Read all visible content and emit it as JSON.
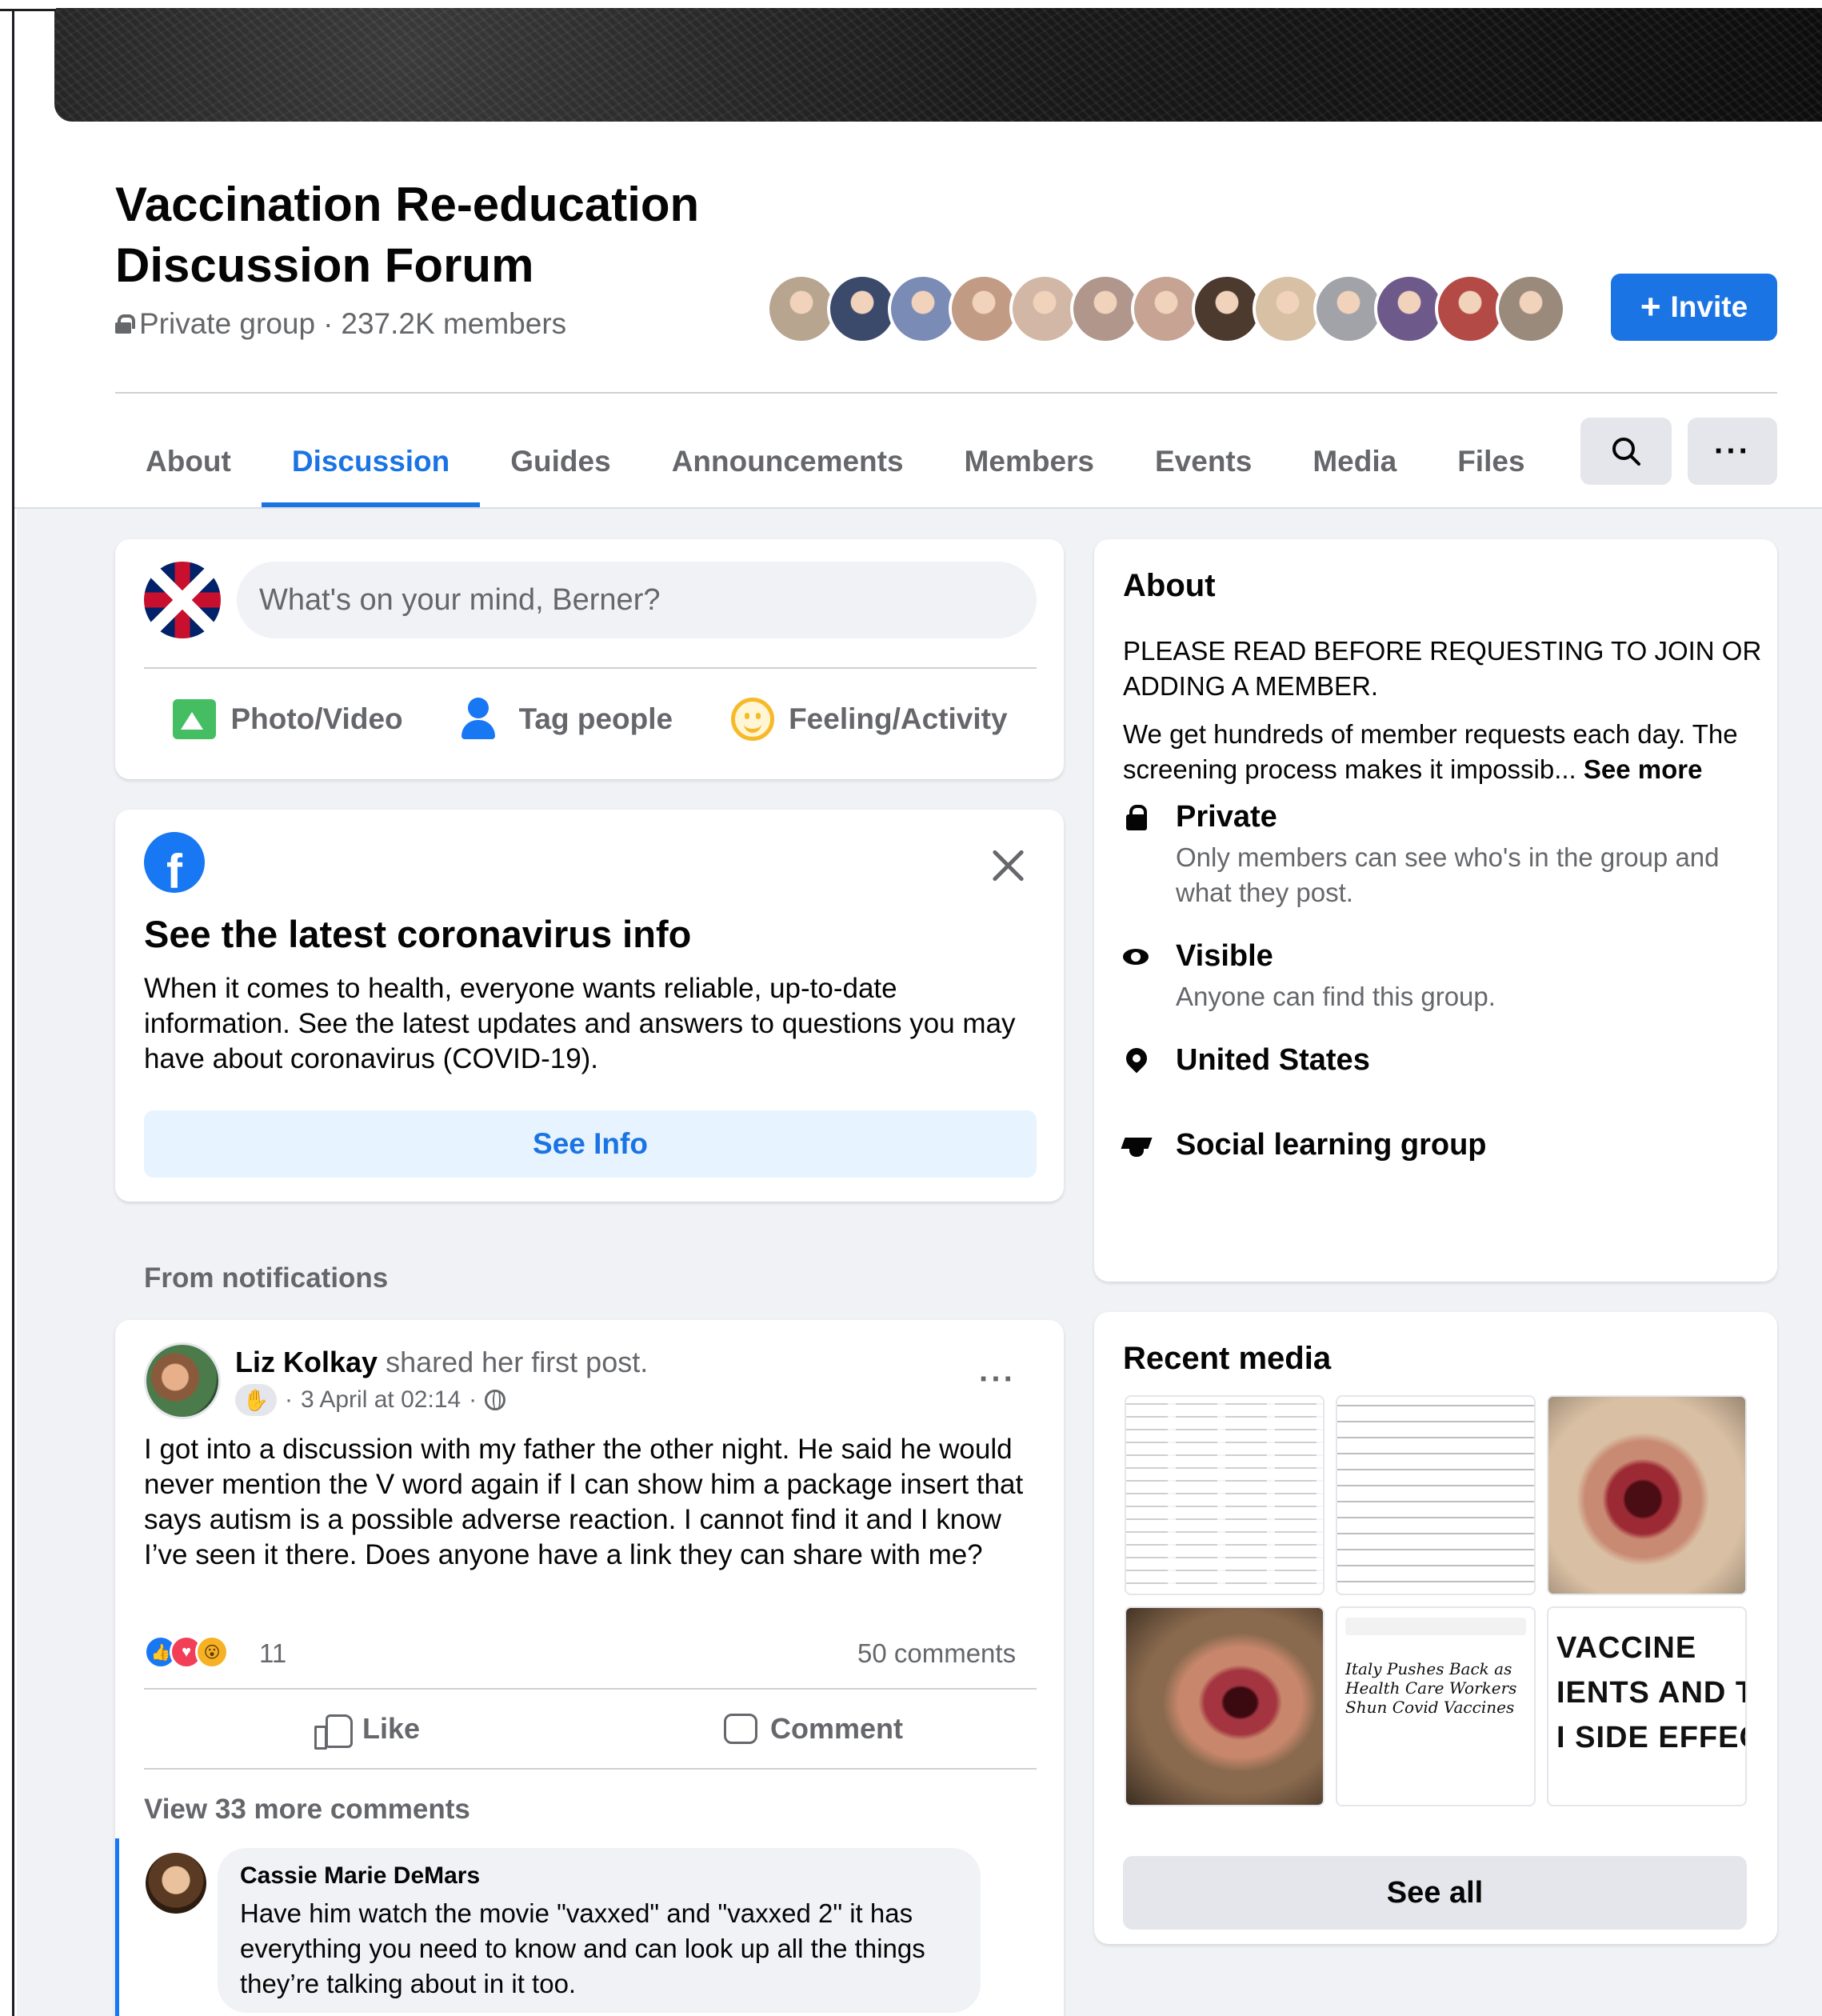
{
  "group": {
    "title_line1": "Vaccination Re-education",
    "title_line2": "Discussion Forum",
    "privacy": "Private group",
    "member_count": "237.2K members",
    "invite_label": "Invite",
    "member_avatar_colors": [
      "#b8a58f",
      "#3b4a6b",
      "#7a8bb5",
      "#c29b85",
      "#d2b7a6",
      "#b1968c",
      "#c6a393",
      "#4d3a2f",
      "#d7c0a4",
      "#a1a3a8",
      "#6e5a8a",
      "#b34a46",
      "#9a8a7c"
    ]
  },
  "tabs": [
    {
      "label": "About",
      "active": false
    },
    {
      "label": "Discussion",
      "active": true
    },
    {
      "label": "Guides",
      "active": false
    },
    {
      "label": "Announcements",
      "active": false
    },
    {
      "label": "Members",
      "active": false
    },
    {
      "label": "Events",
      "active": false
    },
    {
      "label": "Media",
      "active": false
    },
    {
      "label": "Files",
      "active": false
    }
  ],
  "toolbar": {
    "more_label": "···"
  },
  "composer": {
    "placeholder": "What's on your mind, Berner?",
    "actions": [
      {
        "label": "Photo/Video",
        "icon": "photo-video-icon"
      },
      {
        "label": "Tag people",
        "icon": "tag-people-icon"
      },
      {
        "label": "Feeling/Activity",
        "icon": "feeling-icon"
      }
    ]
  },
  "covid_card": {
    "logo": "f",
    "heading": "See the latest coronavirus info",
    "body": "When it comes to health, everyone wants reliable, up-to-date information. See the latest updates and answers to questions you may have about coronavirus (COVID-19).",
    "button": "See Info"
  },
  "feed": {
    "section_label": "From notifications"
  },
  "post": {
    "author": "Liz Kolkay",
    "action_text": "shared her first post.",
    "timestamp": "3 April at 02:14",
    "separator": "·",
    "body": "I got into a discussion with my father the other night. He said he would never mention the V word again if I can show him a package insert that says autism is a possible adverse reaction. I cannot find it and I know I’ve seen it there. Does anyone have a link they can share with me?",
    "reaction_count": "11",
    "comment_count": "50 comments",
    "like_label": "Like",
    "comment_label": "Comment",
    "view_more": "View 33 more comments",
    "menu": "···",
    "comment": {
      "author": "Cassie Marie DeMars",
      "text": "Have him watch the movie \"vaxxed\" and \"vaxxed 2\" it has everything you need to know and can look up all the things they’re talking about in it too."
    }
  },
  "about": {
    "heading": "About",
    "desc1": "PLEASE READ BEFORE REQUESTING TO JOIN OR ADDING A MEMBER.",
    "desc2": "We get hundreds of member requests each day. The screening process makes it impossib...",
    "see_more": "See more",
    "items": [
      {
        "title": "Private",
        "sub": "Only members can see who's in the group and what they post.",
        "icon": "lock-icon"
      },
      {
        "title": "Visible",
        "sub": "Anyone can find this group.",
        "icon": "eye-icon"
      },
      {
        "title": "United States",
        "sub": "",
        "icon": "location-pin-icon"
      },
      {
        "title": "Social learning group",
        "sub": "",
        "icon": "graduation-cap-icon"
      }
    ]
  },
  "recent_media": {
    "heading": "Recent media",
    "news_headline": "Italy Pushes Back as Health Care Workers Shun Covid Vaccines",
    "vaccine_lines": [
      "VACCINE",
      "IENTS AND T",
      "I SIDE EFFEC"
    ],
    "see_all": "See all"
  }
}
